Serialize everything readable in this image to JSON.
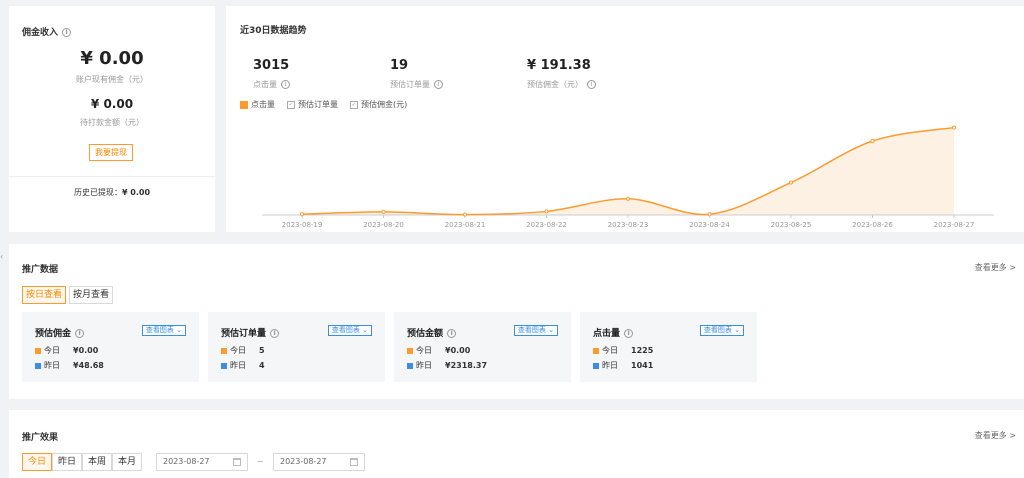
{
  "commission": {
    "title": "佣金收入",
    "balance": "¥ 0.00",
    "balance_label": "账户现有佣金（元）",
    "pending": "¥ 0.00",
    "pending_label": "待打款金额（元）",
    "withdraw_label": "我要提现",
    "history_label": "历史已提现：",
    "history_value": "¥ 0.00"
  },
  "trend": {
    "title": "近30日数据趋势",
    "clicks_value": "3015",
    "clicks_label": "点击量",
    "orders_value": "19",
    "orders_label": "预估订单量",
    "commission_value": "¥ 191.38",
    "commission_label": "预估佣金（元）",
    "legend": [
      "点击量",
      "预估订单量",
      "预估佣金(元)"
    ]
  },
  "chart_data": {
    "type": "area",
    "x": [
      "2023-08-19",
      "2023-08-20",
      "2023-08-21",
      "2023-08-22",
      "2023-08-23",
      "2023-08-24",
      "2023-08-25",
      "2023-08-26",
      "2023-08-27"
    ],
    "series": [
      {
        "name": "点击量",
        "values": [
          10,
          40,
          5,
          45,
          205,
          10,
          410,
          935,
          1105
        ]
      }
    ],
    "ylim": [
      0,
      1150
    ],
    "colors": {
      "line": "#ff9a2e",
      "fill": "#fdf1e3"
    },
    "grid": false
  },
  "promo": {
    "title": "推广数据",
    "more": "查看更多 >",
    "tabs": [
      "按日查看",
      "按月查看"
    ],
    "today_label": "今日",
    "yesterday_label": "昨日",
    "chart_btn": "查看图表",
    "cards": [
      {
        "title": "预估佣金",
        "today": "¥0.00",
        "yesterday": "¥48.68"
      },
      {
        "title": "预估订单量",
        "today": "5",
        "yesterday": "4"
      },
      {
        "title": "预估金额",
        "today": "¥0.00",
        "yesterday": "¥2318.37"
      },
      {
        "title": "点击量",
        "today": "1225",
        "yesterday": "1041"
      }
    ]
  },
  "effect": {
    "title": "推广效果",
    "more": "查看更多 >",
    "tabs": [
      "今日",
      "昨日",
      "本周",
      "本月"
    ],
    "date_start": "2023-08-27",
    "date_sep": "~",
    "date_end": "2023-08-27"
  },
  "colors": {
    "accent": "#ff8800",
    "blue": "#3a8ee6",
    "today_sq": "#ff9a2e",
    "yesterday_sq": "#3a8ee6"
  }
}
